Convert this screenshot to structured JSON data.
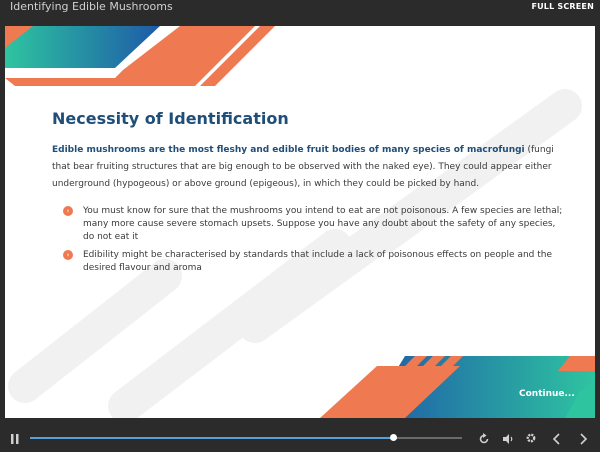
{
  "window": {
    "title": "Identifying Edible Mushrooms",
    "fullscreen_label": "FULL SCREEN"
  },
  "slide": {
    "heading": "Necessity of Identification",
    "intro_bold": "Edible mushrooms are the most fleshy and edible fruit bodies of many species of macrofungi",
    "intro_rest": " (fungi that bear fruiting structures that are big enough to be observed with the naked eye). They could appear either underground (hypogeous) or above ground (epigeous), in which they could be picked by hand.",
    "bullets": [
      "You must know for sure that the mushrooms you intend to eat are not poisonous. A few species are lethal; many more cause severe stomach upsets. Suppose you have any doubt about the safety of any species, do not eat it",
      "Edibility might be characterised by standards that include a lack of poisonous effects on people and the desired flavour and aroma"
    ],
    "continue_label": "Continue...",
    "colors": {
      "heading": "#1f4e79",
      "accent_orange": "#ef7a52",
      "teal": "#2ec4a0",
      "blue": "#1e5aa8"
    }
  },
  "player": {
    "progress": 0.84,
    "icons": [
      "pause-icon",
      "replay-icon",
      "volume-icon",
      "settings-icon",
      "prev-icon",
      "next-icon"
    ]
  }
}
